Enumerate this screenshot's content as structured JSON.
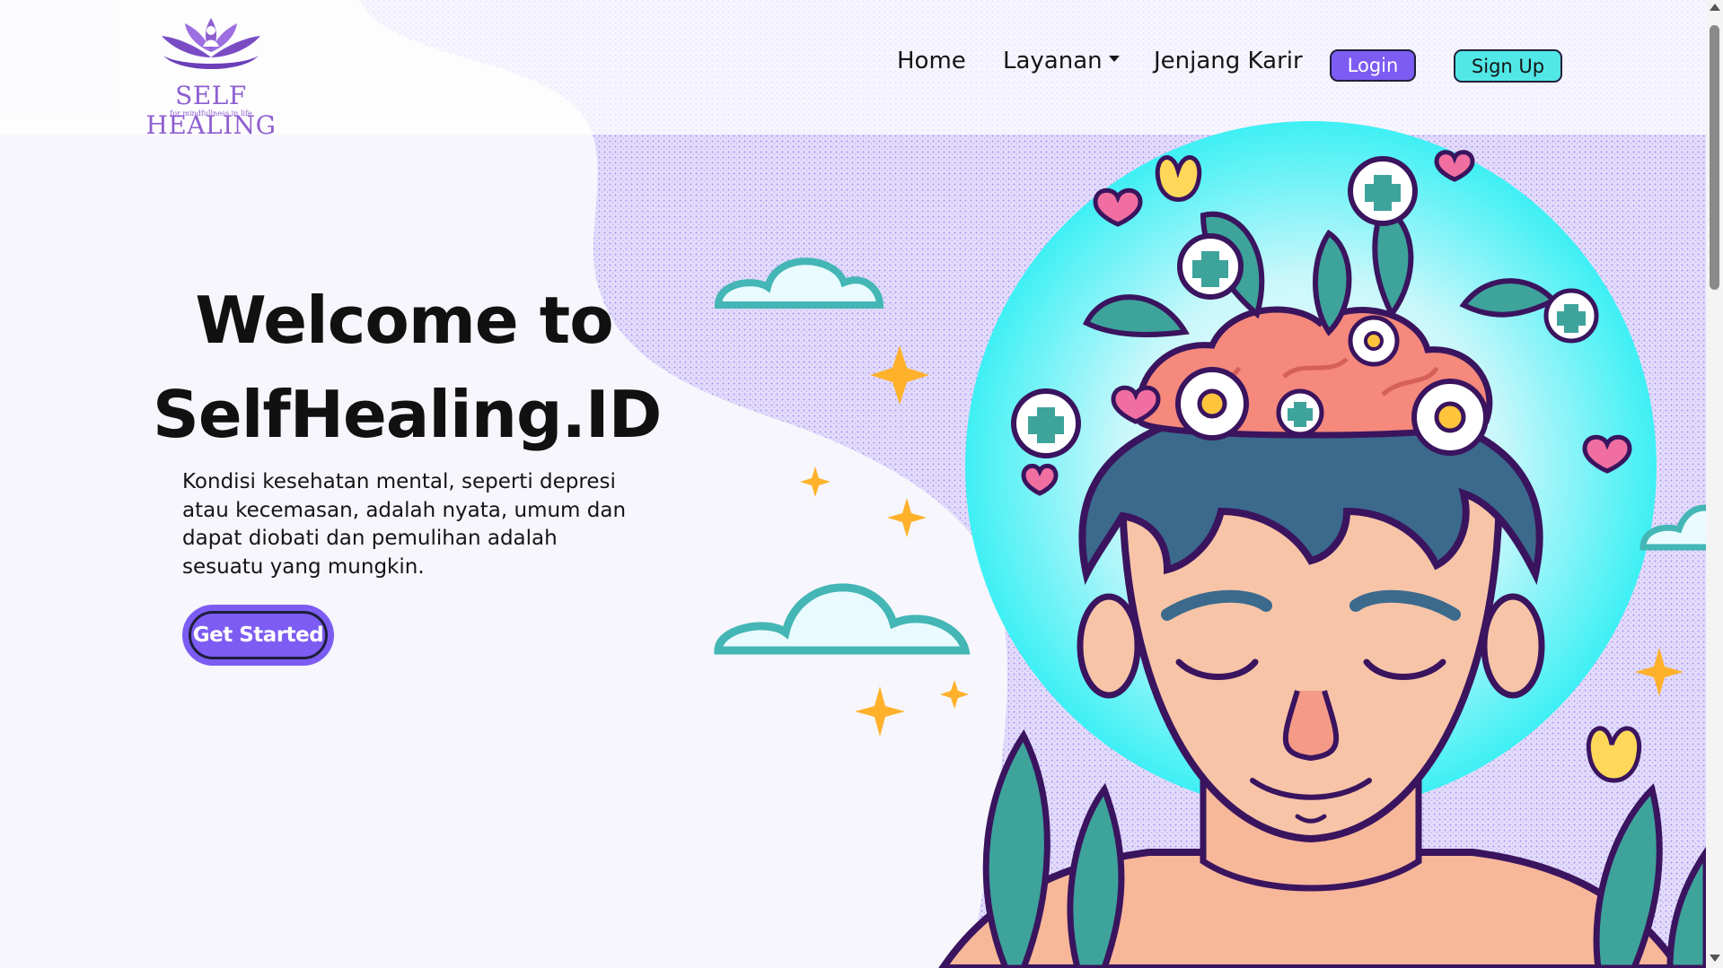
{
  "brand": {
    "name": "SELF HEALING",
    "tagline": "for mindfullness in life",
    "icon": "lotus-meditation-logo"
  },
  "nav": {
    "home": "Home",
    "layanan": "Layanan",
    "jenjang_karir": "Jenjang Karir",
    "login": "Login",
    "signup": "Sign Up"
  },
  "hero": {
    "title_line1": "Welcome to",
    "title_line2": "SelfHealing.ID",
    "description": "Kondisi kesehatan mental, seperti depresi atau kecemasan, adalah nyata, umum dan dapat diobati dan pemulihan adalah sesuatu yang mungkin.",
    "cta": "Get Started",
    "illustration": "meditating-person-brain-flowers-illustration"
  },
  "colors": {
    "accent_purple": "#7c5cf2",
    "accent_cyan": "#52e7e7",
    "logo_purple": "#8e5fd0",
    "background": "#f6f6fc"
  }
}
